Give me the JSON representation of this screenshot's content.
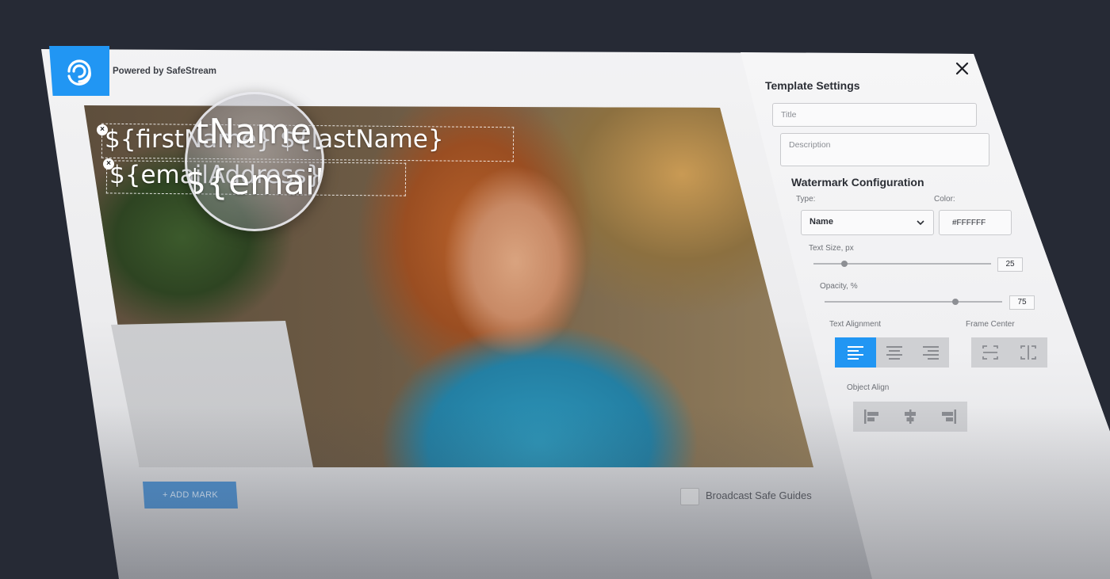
{
  "brand": {
    "powered_by": "Powered by SafeStream"
  },
  "watermark_preview": {
    "line1": "${firstName} ${lastName}",
    "line2": "${emailAddress}",
    "magnified_line1": "tName}",
    "magnified_line2": "${emailA"
  },
  "bottom_bar": {
    "add_mark_label": "+ ADD MARK",
    "broadcast_safe_label": "Broadcast Safe Guides",
    "broadcast_safe_checked": false
  },
  "settings": {
    "title": "Template Settings",
    "title_placeholder": "Title",
    "description_placeholder": "Description",
    "watermark_heading": "Watermark Configuration",
    "type_label": "Type:",
    "type_value": "Name",
    "color_label": "Color:",
    "color_value": "#FFFFFF",
    "text_size_label": "Text Size, px",
    "text_size_value": "25",
    "opacity_label": "Opacity, %",
    "opacity_value": "75",
    "text_alignment_label": "Text Alignment",
    "frame_center_label": "Frame Center",
    "object_align_label": "Object Align"
  },
  "icons": {
    "logo": "safestream-logo-icon",
    "close": "close-icon",
    "chevron": "chevron-down-icon",
    "align": [
      "align-left-icon",
      "align-center-icon",
      "align-right-icon"
    ],
    "frame": [
      "frame-center-horizontal-icon",
      "frame-center-vertical-icon"
    ],
    "object": [
      "object-align-left-icon",
      "object-align-center-icon",
      "object-align-right-icon"
    ]
  },
  "colors": {
    "accent": "#2196f3",
    "background": "#262a35",
    "add_mark": "#4f8fcc"
  }
}
